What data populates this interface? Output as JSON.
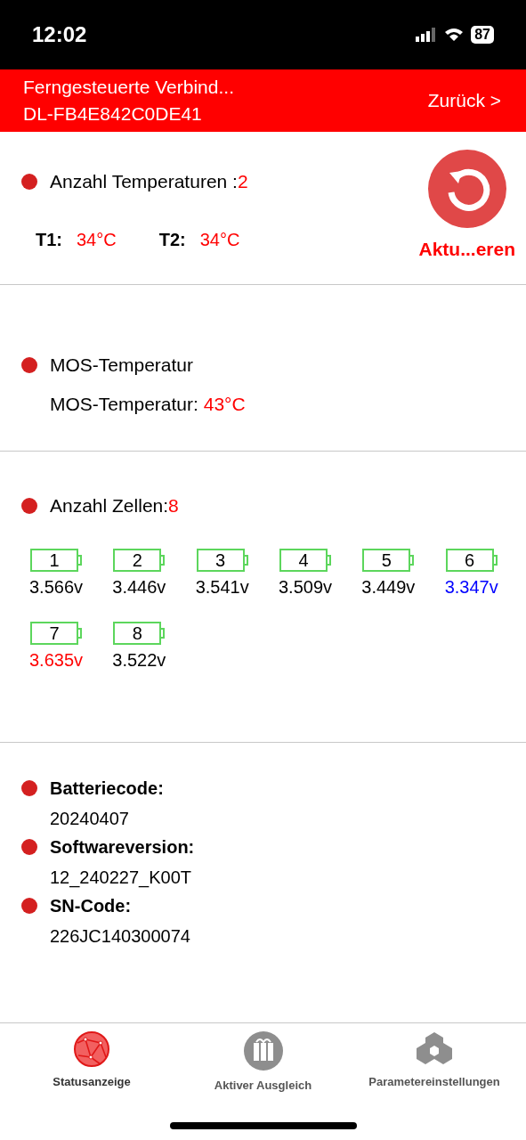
{
  "status_bar": {
    "time": "12:02",
    "battery": "87"
  },
  "header": {
    "title": "Ferngesteuerte Verbind...",
    "device": "DL-FB4E842C0DE41",
    "back": "Zurück >"
  },
  "temperatures": {
    "label": "Anzahl Temperaturen :",
    "count": "2",
    "refresh": "Aktu...eren",
    "items": [
      {
        "label": "T1:",
        "value": "34°C"
      },
      {
        "label": "T2:",
        "value": "34°C"
      }
    ]
  },
  "mos": {
    "heading": "MOS-Temperatur",
    "label": "MOS-Temperatur:",
    "value": "43°C"
  },
  "cells": {
    "label": "Anzahl Zellen:",
    "count": "8",
    "items": [
      {
        "number": "1",
        "voltage": "3.566v",
        "color": "#000000"
      },
      {
        "number": "2",
        "voltage": "3.446v",
        "color": "#000000"
      },
      {
        "number": "3",
        "voltage": "3.541v",
        "color": "#000000"
      },
      {
        "number": "4",
        "voltage": "3.509v",
        "color": "#000000"
      },
      {
        "number": "5",
        "voltage": "3.449v",
        "color": "#000000"
      },
      {
        "number": "6",
        "voltage": "3.347v",
        "color": "#0000ff"
      },
      {
        "number": "7",
        "voltage": "3.635v",
        "color": "#ff0000"
      },
      {
        "number": "8",
        "voltage": "3.522v",
        "color": "#000000"
      }
    ]
  },
  "info": [
    {
      "label": "Batteriecode:",
      "value": "20240407"
    },
    {
      "label": "Softwareversion:",
      "value": "12_240227_K00T"
    },
    {
      "label": "SN-Code:",
      "value": "226JC140300074"
    }
  ],
  "tabs": [
    {
      "label": "Statusanzeige",
      "selected": true,
      "kind": "globe"
    },
    {
      "label": "Aktiver Ausgleich",
      "selected": false,
      "kind": "balance"
    },
    {
      "label": "Parametereinstellungen",
      "selected": false,
      "kind": "hex"
    }
  ]
}
